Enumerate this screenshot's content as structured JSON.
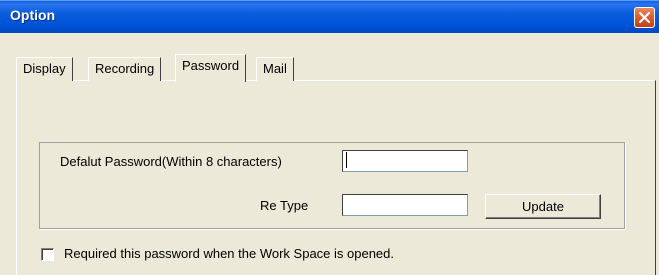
{
  "window": {
    "title": "Option"
  },
  "tabs": [
    {
      "label": "Display"
    },
    {
      "label": "Recording"
    },
    {
      "label": "Password"
    },
    {
      "label": "Mail"
    }
  ],
  "active_tab": "Password",
  "password": {
    "default_label": "Defalut Password(Within 8 characters)",
    "default_value": "",
    "retype_label": "Re Type",
    "retype_value": "",
    "update_label": "Update",
    "require_label": "Required this password when the Work Space is opened.",
    "require_checked": false
  }
}
